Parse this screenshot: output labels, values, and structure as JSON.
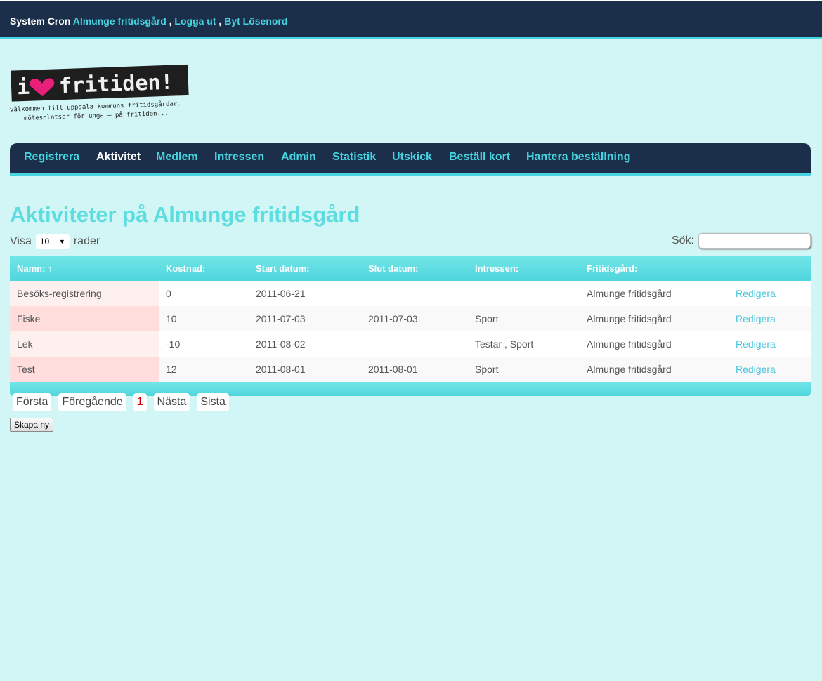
{
  "topbar": {
    "user": "System Cron",
    "place_link": "Almunge fritidsgård",
    "logout_link": "Logga ut",
    "change_password_link": "Byt Lösenord",
    "separator": ","
  },
  "logo": {
    "text": "i ♥ fritiden!",
    "tagline_1": "välkommen till uppsala kommuns fritidsgårdar.",
    "tagline_2": "mötesplatser för unga – på fritiden..."
  },
  "nav": [
    {
      "label": "Registrera"
    },
    {
      "label": "Aktivitet",
      "active": true
    },
    {
      "label": "Medlem"
    },
    {
      "label": "Intressen"
    },
    {
      "label": "Admin"
    },
    {
      "label": "Statistik"
    },
    {
      "label": "Utskick"
    },
    {
      "label": "Beställ kort"
    },
    {
      "label": "Hantera beställning"
    }
  ],
  "page_title": "Aktiviteter på Almunge fritidsgård",
  "length": {
    "prefix": "Visa",
    "value": "10",
    "suffix": "rader"
  },
  "search": {
    "label": "Sök:",
    "value": ""
  },
  "table": {
    "headers": [
      "Namn: ↑",
      "Kostnad:",
      "Start datum:",
      "Slut datum:",
      "Intressen:",
      "Fritidsgård:",
      ""
    ],
    "rows": [
      [
        "Besöks-registrering",
        "0",
        "2011-06-21",
        "",
        "",
        "Almunge fritidsgård",
        "Redigera"
      ],
      [
        "Fiske",
        "10",
        "2011-07-03",
        "2011-07-03",
        "Sport",
        "Almunge fritidsgård",
        "Redigera"
      ],
      [
        "Lek",
        "-10",
        "2011-08-02",
        "",
        "Testar , Sport",
        "Almunge fritidsgård",
        "Redigera"
      ],
      [
        "Test",
        "12",
        "2011-08-01",
        "2011-08-01",
        "Sport",
        "Almunge fritidsgård",
        "Redigera"
      ]
    ]
  },
  "pager": {
    "first": "Första",
    "previous": "Föregående",
    "current": "1",
    "next": "Nästa",
    "last": "Sista"
  },
  "create_button": "Skapa ny",
  "colors": {
    "background": "#d2f5f5",
    "header_dark": "#1b2f4a",
    "accent": "#46d4e0",
    "title": "#5ddde0",
    "logo_heart": "#e8207a"
  }
}
